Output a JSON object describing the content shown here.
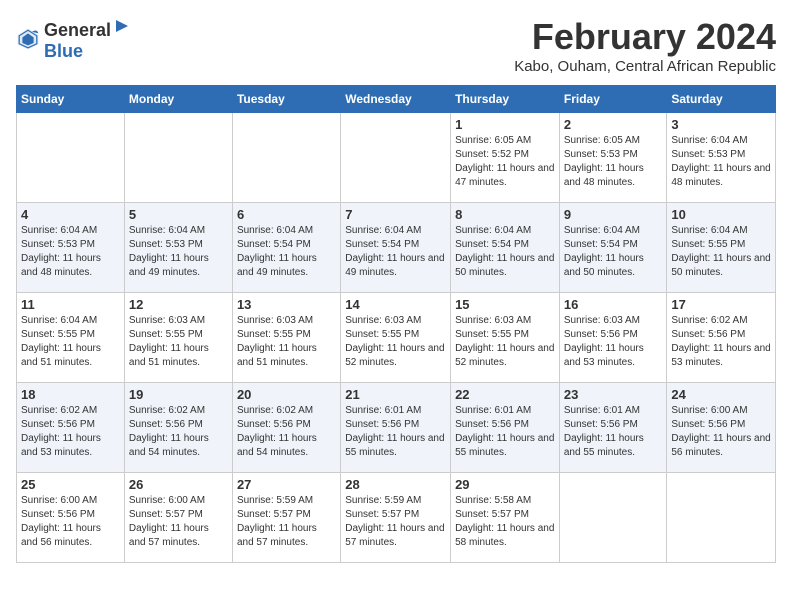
{
  "logo": {
    "general": "General",
    "blue": "Blue"
  },
  "title": "February 2024",
  "subtitle": "Kabo, Ouham, Central African Republic",
  "days_of_week": [
    "Sunday",
    "Monday",
    "Tuesday",
    "Wednesday",
    "Thursday",
    "Friday",
    "Saturday"
  ],
  "weeks": [
    [
      {
        "day": "",
        "info": ""
      },
      {
        "day": "",
        "info": ""
      },
      {
        "day": "",
        "info": ""
      },
      {
        "day": "",
        "info": ""
      },
      {
        "day": "1",
        "info": "Sunrise: 6:05 AM\nSunset: 5:52 PM\nDaylight: 11 hours and 47 minutes."
      },
      {
        "day": "2",
        "info": "Sunrise: 6:05 AM\nSunset: 5:53 PM\nDaylight: 11 hours and 48 minutes."
      },
      {
        "day": "3",
        "info": "Sunrise: 6:04 AM\nSunset: 5:53 PM\nDaylight: 11 hours and 48 minutes."
      }
    ],
    [
      {
        "day": "4",
        "info": "Sunrise: 6:04 AM\nSunset: 5:53 PM\nDaylight: 11 hours and 48 minutes."
      },
      {
        "day": "5",
        "info": "Sunrise: 6:04 AM\nSunset: 5:53 PM\nDaylight: 11 hours and 49 minutes."
      },
      {
        "day": "6",
        "info": "Sunrise: 6:04 AM\nSunset: 5:54 PM\nDaylight: 11 hours and 49 minutes."
      },
      {
        "day": "7",
        "info": "Sunrise: 6:04 AM\nSunset: 5:54 PM\nDaylight: 11 hours and 49 minutes."
      },
      {
        "day": "8",
        "info": "Sunrise: 6:04 AM\nSunset: 5:54 PM\nDaylight: 11 hours and 50 minutes."
      },
      {
        "day": "9",
        "info": "Sunrise: 6:04 AM\nSunset: 5:54 PM\nDaylight: 11 hours and 50 minutes."
      },
      {
        "day": "10",
        "info": "Sunrise: 6:04 AM\nSunset: 5:55 PM\nDaylight: 11 hours and 50 minutes."
      }
    ],
    [
      {
        "day": "11",
        "info": "Sunrise: 6:04 AM\nSunset: 5:55 PM\nDaylight: 11 hours and 51 minutes."
      },
      {
        "day": "12",
        "info": "Sunrise: 6:03 AM\nSunset: 5:55 PM\nDaylight: 11 hours and 51 minutes."
      },
      {
        "day": "13",
        "info": "Sunrise: 6:03 AM\nSunset: 5:55 PM\nDaylight: 11 hours and 51 minutes."
      },
      {
        "day": "14",
        "info": "Sunrise: 6:03 AM\nSunset: 5:55 PM\nDaylight: 11 hours and 52 minutes."
      },
      {
        "day": "15",
        "info": "Sunrise: 6:03 AM\nSunset: 5:55 PM\nDaylight: 11 hours and 52 minutes."
      },
      {
        "day": "16",
        "info": "Sunrise: 6:03 AM\nSunset: 5:56 PM\nDaylight: 11 hours and 53 minutes."
      },
      {
        "day": "17",
        "info": "Sunrise: 6:02 AM\nSunset: 5:56 PM\nDaylight: 11 hours and 53 minutes."
      }
    ],
    [
      {
        "day": "18",
        "info": "Sunrise: 6:02 AM\nSunset: 5:56 PM\nDaylight: 11 hours and 53 minutes."
      },
      {
        "day": "19",
        "info": "Sunrise: 6:02 AM\nSunset: 5:56 PM\nDaylight: 11 hours and 54 minutes."
      },
      {
        "day": "20",
        "info": "Sunrise: 6:02 AM\nSunset: 5:56 PM\nDaylight: 11 hours and 54 minutes."
      },
      {
        "day": "21",
        "info": "Sunrise: 6:01 AM\nSunset: 5:56 PM\nDaylight: 11 hours and 55 minutes."
      },
      {
        "day": "22",
        "info": "Sunrise: 6:01 AM\nSunset: 5:56 PM\nDaylight: 11 hours and 55 minutes."
      },
      {
        "day": "23",
        "info": "Sunrise: 6:01 AM\nSunset: 5:56 PM\nDaylight: 11 hours and 55 minutes."
      },
      {
        "day": "24",
        "info": "Sunrise: 6:00 AM\nSunset: 5:56 PM\nDaylight: 11 hours and 56 minutes."
      }
    ],
    [
      {
        "day": "25",
        "info": "Sunrise: 6:00 AM\nSunset: 5:56 PM\nDaylight: 11 hours and 56 minutes."
      },
      {
        "day": "26",
        "info": "Sunrise: 6:00 AM\nSunset: 5:57 PM\nDaylight: 11 hours and 57 minutes."
      },
      {
        "day": "27",
        "info": "Sunrise: 5:59 AM\nSunset: 5:57 PM\nDaylight: 11 hours and 57 minutes."
      },
      {
        "day": "28",
        "info": "Sunrise: 5:59 AM\nSunset: 5:57 PM\nDaylight: 11 hours and 57 minutes."
      },
      {
        "day": "29",
        "info": "Sunrise: 5:58 AM\nSunset: 5:57 PM\nDaylight: 11 hours and 58 minutes."
      },
      {
        "day": "",
        "info": ""
      },
      {
        "day": "",
        "info": ""
      }
    ]
  ]
}
